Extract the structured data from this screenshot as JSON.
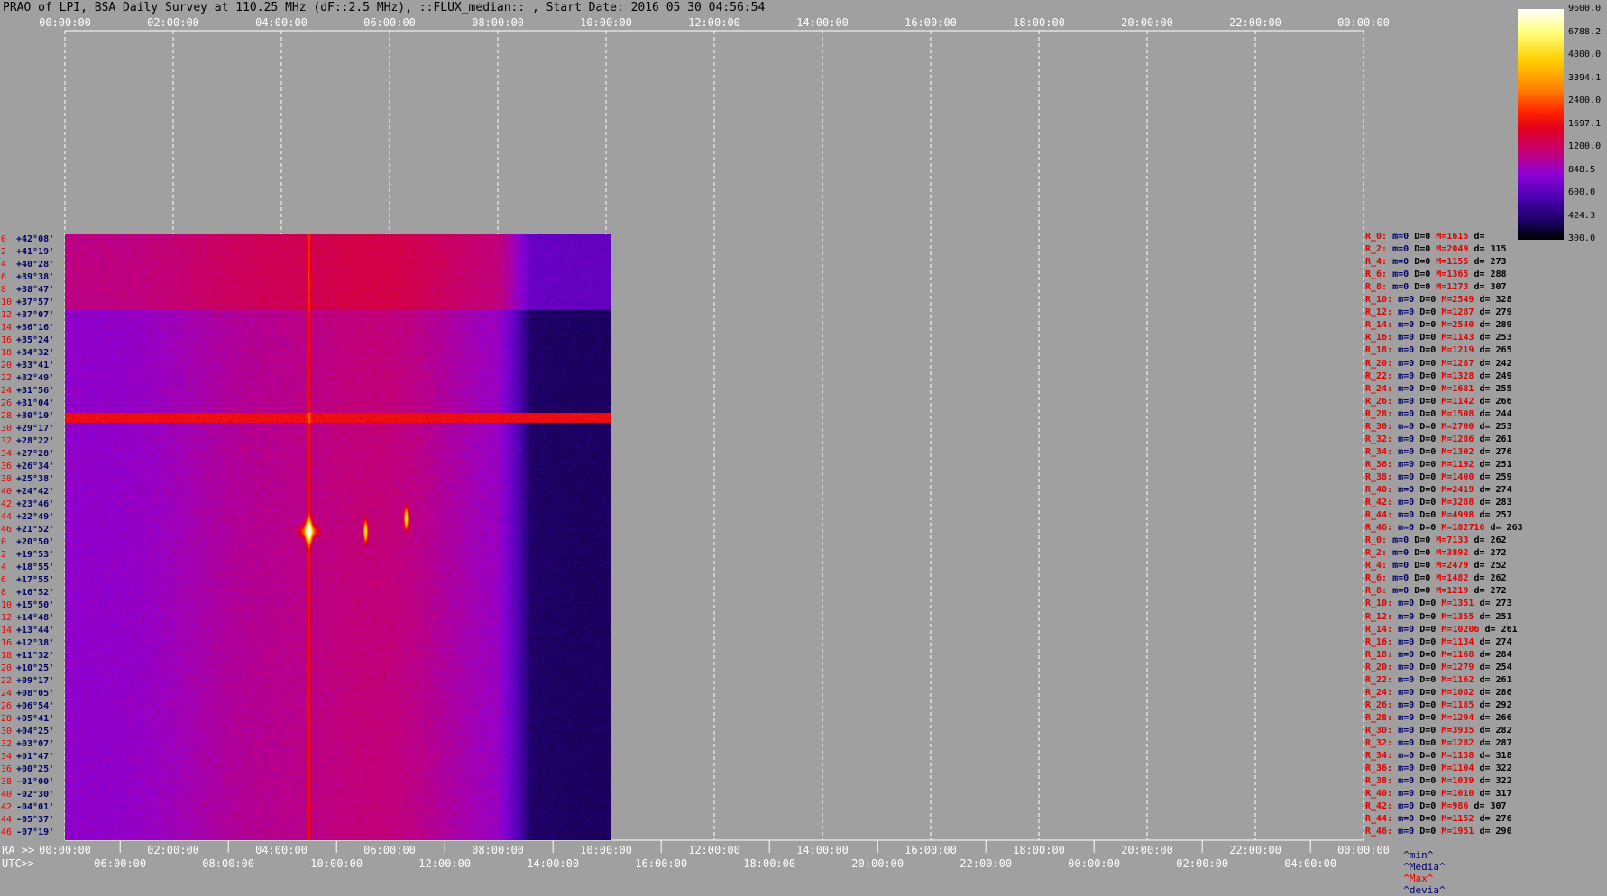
{
  "title": "PRAO of LPI, BSA Daily Survey at 110.25 MHz (dF::2.5 MHz), ::FLUX_median:: , Start Date: 2016 05 30 04:56:54",
  "ra_axis_label": "RA >>",
  "utc_axis_label": "UTC>>",
  "top_ticks": [
    "00:00:00",
    "02:00:00",
    "04:00:00",
    "06:00:00",
    "08:00:00",
    "10:00:00",
    "12:00:00",
    "14:00:00",
    "16:00:00",
    "18:00:00",
    "20:00:00",
    "22:00:00",
    "00:00:00"
  ],
  "ra_ticks": [
    "00:00:00",
    "02:00:00",
    "04:00:00",
    "06:00:00",
    "08:00:00",
    "10:00:00",
    "12:00:00",
    "14:00:00",
    "16:00:00",
    "18:00:00",
    "20:00:00",
    "22:00:00",
    "00:00:00"
  ],
  "utc_ticks": [
    "06:00:00",
    "08:00:00",
    "10:00:00",
    "12:00:00",
    "14:00:00",
    "16:00:00",
    "18:00:00",
    "20:00:00",
    "22:00:00",
    "00:00:00",
    "02:00:00",
    "04:00:00"
  ],
  "colorbar_labels": [
    "9600.0",
    "6788.2",
    "4800.0",
    "3394.1",
    "2400.0",
    "1697.1",
    "1200.0",
    "848.5",
    "600.0",
    "424.3",
    "300.0"
  ],
  "legend_footer": {
    "min": "^min^",
    "median": "^Media^",
    "max": "^Max^",
    "dev": "^devia^"
  },
  "declinations": [
    {
      "r": "0",
      "d": "+42°08'"
    },
    {
      "r": "2",
      "d": "+41°19'"
    },
    {
      "r": "4",
      "d": "+40°28'"
    },
    {
      "r": "6",
      "d": "+39°38'"
    },
    {
      "r": "8",
      "d": "+38°47'"
    },
    {
      "r": "10",
      "d": "+37°57'"
    },
    {
      "r": "12",
      "d": "+37°07'"
    },
    {
      "r": "14",
      "d": "+36°16'"
    },
    {
      "r": "16",
      "d": "+35°24'"
    },
    {
      "r": "18",
      "d": "+34°32'"
    },
    {
      "r": "20",
      "d": "+33°41'"
    },
    {
      "r": "22",
      "d": "+32°49'"
    },
    {
      "r": "24",
      "d": "+31°56'"
    },
    {
      "r": "26",
      "d": "+31°04'"
    },
    {
      "r": "28",
      "d": "+30°10'"
    },
    {
      "r": "30",
      "d": "+29°17'"
    },
    {
      "r": "32",
      "d": "+28°22'"
    },
    {
      "r": "34",
      "d": "+27°28'"
    },
    {
      "r": "36",
      "d": "+26°34'"
    },
    {
      "r": "38",
      "d": "+25°38'"
    },
    {
      "r": "40",
      "d": "+24°42'"
    },
    {
      "r": "42",
      "d": "+23°46'"
    },
    {
      "r": "44",
      "d": "+22°49'"
    },
    {
      "r": "46",
      "d": "+21°52'"
    },
    {
      "r": "0",
      "d": "+20°50'"
    },
    {
      "r": "2",
      "d": "+19°53'"
    },
    {
      "r": "4",
      "d": "+18°55'"
    },
    {
      "r": "6",
      "d": "+17°55'"
    },
    {
      "r": "8",
      "d": "+16°52'"
    },
    {
      "r": "10",
      "d": "+15°50'"
    },
    {
      "r": "12",
      "d": "+14°48'"
    },
    {
      "r": "14",
      "d": "+13°44'"
    },
    {
      "r": "16",
      "d": "+12°38'"
    },
    {
      "r": "18",
      "d": "+11°32'"
    },
    {
      "r": "20",
      "d": "+10°25'"
    },
    {
      "r": "22",
      "d": "+09°17'"
    },
    {
      "r": "24",
      "d": "+08°05'"
    },
    {
      "r": "26",
      "d": "+06°54'"
    },
    {
      "r": "28",
      "d": "+05°41'"
    },
    {
      "r": "30",
      "d": "+04°25'"
    },
    {
      "r": "32",
      "d": "+03°07'"
    },
    {
      "r": "34",
      "d": "+01°47'"
    },
    {
      "r": "36",
      "d": "+00°25'"
    },
    {
      "r": "38",
      "d": "-01°00'"
    },
    {
      "r": "40",
      "d": "-02°30'"
    },
    {
      "r": "42",
      "d": "-04°01'"
    },
    {
      "r": "44",
      "d": "-05°37'"
    },
    {
      "r": "46",
      "d": "-07°19'"
    }
  ],
  "stats": [
    {
      "r": "R_0:",
      "m": "m=0",
      "D": "D=0",
      "M": "M=1615",
      "d": "d="
    },
    {
      "r": "R_2:",
      "m": "m=0",
      "D": "D=0",
      "M": "M=2049",
      "d": "d= 315"
    },
    {
      "r": "R_4:",
      "m": "m=0",
      "D": "D=0",
      "M": "M=1155",
      "d": "d= 273"
    },
    {
      "r": "R_6:",
      "m": "m=0",
      "D": "D=0",
      "M": "M=1365",
      "d": "d= 288"
    },
    {
      "r": "R_8:",
      "m": "m=0",
      "D": "D=0",
      "M": "M=1273",
      "d": "d= 307"
    },
    {
      "r": "R_10:",
      "m": "m=0",
      "D": "D=0",
      "M": "M=2549",
      "d": "d= 328"
    },
    {
      "r": "R_12:",
      "m": "m=0",
      "D": "D=0",
      "M": "M=1287",
      "d": "d= 279"
    },
    {
      "r": "R_14:",
      "m": "m=0",
      "D": "D=0",
      "M": "M=2540",
      "d": "d= 289"
    },
    {
      "r": "R_16:",
      "m": "m=0",
      "D": "D=0",
      "M": "M=1143",
      "d": "d= 253"
    },
    {
      "r": "R_18:",
      "m": "m=0",
      "D": "D=0",
      "M": "M=1219",
      "d": "d= 265"
    },
    {
      "r": "R_20:",
      "m": "m=0",
      "D": "D=0",
      "M": "M=1287",
      "d": "d= 242"
    },
    {
      "r": "R_22:",
      "m": "m=0",
      "D": "D=0",
      "M": "M=1328",
      "d": "d= 249"
    },
    {
      "r": "R_24:",
      "m": "m=0",
      "D": "D=0",
      "M": "M=1681",
      "d": "d= 255"
    },
    {
      "r": "R_26:",
      "m": "m=0",
      "D": "D=0",
      "M": "M=1142",
      "d": "d= 266"
    },
    {
      "r": "R_28:",
      "m": "m=0",
      "D": "D=0",
      "M": "M=1508",
      "d": "d= 244"
    },
    {
      "r": "R_30:",
      "m": "m=0",
      "D": "D=0",
      "M": "M=2700",
      "d": "d= 253"
    },
    {
      "r": "R_32:",
      "m": "m=0",
      "D": "D=0",
      "M": "M=1286",
      "d": "d= 261"
    },
    {
      "r": "R_34:",
      "m": "m=0",
      "D": "D=0",
      "M": "M=1302",
      "d": "d= 276"
    },
    {
      "r": "R_36:",
      "m": "m=0",
      "D": "D=0",
      "M": "M=1192",
      "d": "d= 251"
    },
    {
      "r": "R_38:",
      "m": "m=0",
      "D": "D=0",
      "M": "M=1400",
      "d": "d= 259"
    },
    {
      "r": "R_40:",
      "m": "m=0",
      "D": "D=0",
      "M": "M=2419",
      "d": "d= 274"
    },
    {
      "r": "R_42:",
      "m": "m=0",
      "D": "D=0",
      "M": "M=3288",
      "d": "d= 283"
    },
    {
      "r": "R_44:",
      "m": "m=0",
      "D": "D=0",
      "M": "M=4998",
      "d": "d= 257"
    },
    {
      "r": "R_46:",
      "m": "m=0",
      "D": "D=0",
      "M": "M=182716",
      "d": "d= 263"
    },
    {
      "r": "R_0:",
      "m": "m=0",
      "D": "D=0",
      "M": "M=7133",
      "d": "d= 262"
    },
    {
      "r": "R_2:",
      "m": "m=0",
      "D": "D=0",
      "M": "M=3892",
      "d": "d= 272"
    },
    {
      "r": "R_4:",
      "m": "m=0",
      "D": "D=0",
      "M": "M=2479",
      "d": "d= 252"
    },
    {
      "r": "R_6:",
      "m": "m=0",
      "D": "D=0",
      "M": "M=1482",
      "d": "d= 262"
    },
    {
      "r": "R_8:",
      "m": "m=0",
      "D": "D=0",
      "M": "M=1219",
      "d": "d= 272"
    },
    {
      "r": "R_10:",
      "m": "m=0",
      "D": "D=0",
      "M": "M=1351",
      "d": "d= 273"
    },
    {
      "r": "R_12:",
      "m": "m=0",
      "D": "D=0",
      "M": "M=1355",
      "d": "d= 251"
    },
    {
      "r": "R_14:",
      "m": "m=0",
      "D": "D=0",
      "M": "M=10206",
      "d": "d= 261"
    },
    {
      "r": "R_16:",
      "m": "m=0",
      "D": "D=0",
      "M": "M=1134",
      "d": "d= 274"
    },
    {
      "r": "R_18:",
      "m": "m=0",
      "D": "D=0",
      "M": "M=1168",
      "d": "d= 284"
    },
    {
      "r": "R_20:",
      "m": "m=0",
      "D": "D=0",
      "M": "M=1279",
      "d": "d= 254"
    },
    {
      "r": "R_22:",
      "m": "m=0",
      "D": "D=0",
      "M": "M=1162",
      "d": "d= 261"
    },
    {
      "r": "R_24:",
      "m": "m=0",
      "D": "D=0",
      "M": "M=1082",
      "d": "d= 286"
    },
    {
      "r": "R_26:",
      "m": "m=0",
      "D": "D=0",
      "M": "M=1185",
      "d": "d= 292"
    },
    {
      "r": "R_28:",
      "m": "m=0",
      "D": "D=0",
      "M": "M=1294",
      "d": "d= 266"
    },
    {
      "r": "R_30:",
      "m": "m=0",
      "D": "D=0",
      "M": "M=3935",
      "d": "d= 282"
    },
    {
      "r": "R_32:",
      "m": "m=0",
      "D": "D=0",
      "M": "M=1282",
      "d": "d= 287"
    },
    {
      "r": "R_34:",
      "m": "m=0",
      "D": "D=0",
      "M": "M=1158",
      "d": "d= 318"
    },
    {
      "r": "R_36:",
      "m": "m=0",
      "D": "D=0",
      "M": "M=1104",
      "d": "d= 322"
    },
    {
      "r": "R_38:",
      "m": "m=0",
      "D": "D=0",
      "M": "M=1039",
      "d": "d= 322"
    },
    {
      "r": "R_40:",
      "m": "m=0",
      "D": "D=0",
      "M": "M=1010",
      "d": "d= 317"
    },
    {
      "r": "R_42:",
      "m": "m=0",
      "D": "D=0",
      "M": "M=986",
      "d": "d= 307"
    },
    {
      "r": "R_44:",
      "m": "m=0",
      "D": "D=0",
      "M": "M=1152",
      "d": "d= 276"
    },
    {
      "r": "R_46:",
      "m": "m=0",
      "D": "D=0",
      "M": "M=1951",
      "d": "d= 290"
    }
  ],
  "chart_data": {
    "type": "heatmap",
    "title": "PRAO of LPI, BSA Daily Survey at 110.25 MHz (dF::2.5 MHz), ::FLUX_median:: , Start Date: 2016 05 30 04:56:54",
    "x_unit": "RA (hours)",
    "x_range": [
      0,
      24
    ],
    "data_extent_ra_hours": [
      0,
      10.1
    ],
    "y_unit": "Dec",
    "colorscale_min": 300.0,
    "colorscale_max": 9600.0,
    "bright_sources": [
      {
        "ra_hours": 4.5,
        "dec": "+21°52'",
        "peak": "M=182716"
      },
      {
        "ra_hours": 5.55,
        "dec": "+21°52'",
        "peak": "high"
      },
      {
        "ra_hours": 6.3,
        "dec": "+22°49'",
        "peak": "high"
      }
    ],
    "interference_row_dec": "+30°10'",
    "colors": {
      "low": "#1a0060",
      "mid": "#9a00e0",
      "high": "#ff2000",
      "peak": "#ffffff",
      "background": "#a0a0a0"
    }
  }
}
